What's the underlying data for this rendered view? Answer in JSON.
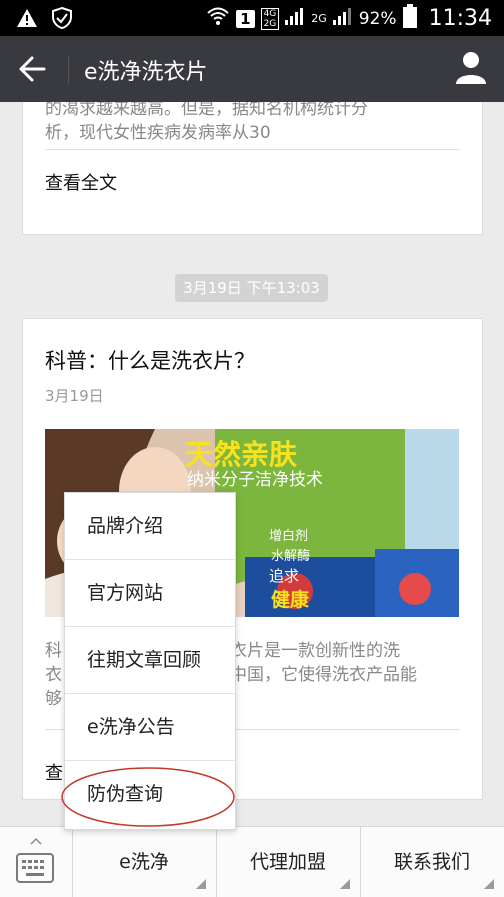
{
  "status_bar": {
    "network_4g": "4G",
    "network_2g_a": "2G",
    "sim_slot": "1",
    "network_2g_b": "2G",
    "battery_percent": "92%",
    "time": "11:34"
  },
  "title_bar": {
    "title": "e洗净洗衣片"
  },
  "card1": {
    "excerpt_line1": "的渴求越来越高。但是，据知名机构统计分",
    "excerpt_line2": "析，现代女性疾病发病率从30",
    "read_more": "查看全文"
  },
  "timestamp": "3月19日 下午13:03",
  "card2": {
    "title": "科普：什么是洗衣片？",
    "date": "3月19日",
    "banner": {
      "headline": "天然亲肤",
      "subtitle": "纳米分子洁净技术",
      "fragment_a": "增白剂",
      "fragment_b": "水解酶",
      "fragment_c": "追求",
      "fragment_d": "健康"
    },
    "summary_line1": "科",
    "summary_line1_rest": "洗衣片是一款创新性的洗",
    "summary_line2": "衣",
    "summary_line2_rest": "往中国，它使得洗衣产品能",
    "summary_line3": "够",
    "read_more": "查"
  },
  "popup_menu": {
    "items": [
      "品牌介绍",
      "官方网站",
      "往期文章回顾",
      "e洗净公告",
      "防伪查询"
    ]
  },
  "bottom_menu": {
    "tab1": "e洗净",
    "tab2": "代理加盟",
    "tab3": "联系我们"
  },
  "colors": {
    "title_bar": "#393a3f",
    "page_bg": "#ebebeb",
    "highlight_circle": "#c0392b",
    "banner_green": "#7cb63e"
  }
}
